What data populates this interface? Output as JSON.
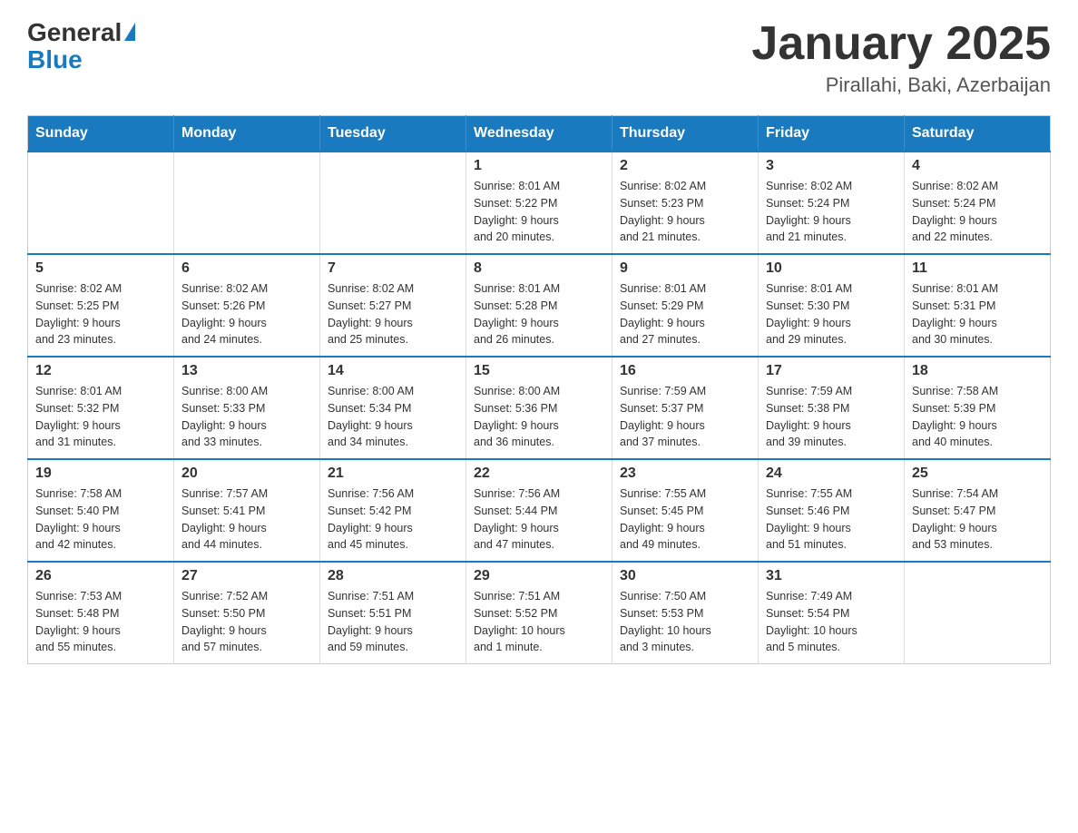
{
  "logo": {
    "general": "General",
    "blue": "Blue"
  },
  "title": "January 2025",
  "subtitle": "Pirallahi, Baki, Azerbaijan",
  "days_of_week": [
    "Sunday",
    "Monday",
    "Tuesday",
    "Wednesday",
    "Thursday",
    "Friday",
    "Saturday"
  ],
  "weeks": [
    [
      {
        "day": "",
        "info": ""
      },
      {
        "day": "",
        "info": ""
      },
      {
        "day": "",
        "info": ""
      },
      {
        "day": "1",
        "info": "Sunrise: 8:01 AM\nSunset: 5:22 PM\nDaylight: 9 hours\nand 20 minutes."
      },
      {
        "day": "2",
        "info": "Sunrise: 8:02 AM\nSunset: 5:23 PM\nDaylight: 9 hours\nand 21 minutes."
      },
      {
        "day": "3",
        "info": "Sunrise: 8:02 AM\nSunset: 5:24 PM\nDaylight: 9 hours\nand 21 minutes."
      },
      {
        "day": "4",
        "info": "Sunrise: 8:02 AM\nSunset: 5:24 PM\nDaylight: 9 hours\nand 22 minutes."
      }
    ],
    [
      {
        "day": "5",
        "info": "Sunrise: 8:02 AM\nSunset: 5:25 PM\nDaylight: 9 hours\nand 23 minutes."
      },
      {
        "day": "6",
        "info": "Sunrise: 8:02 AM\nSunset: 5:26 PM\nDaylight: 9 hours\nand 24 minutes."
      },
      {
        "day": "7",
        "info": "Sunrise: 8:02 AM\nSunset: 5:27 PM\nDaylight: 9 hours\nand 25 minutes."
      },
      {
        "day": "8",
        "info": "Sunrise: 8:01 AM\nSunset: 5:28 PM\nDaylight: 9 hours\nand 26 minutes."
      },
      {
        "day": "9",
        "info": "Sunrise: 8:01 AM\nSunset: 5:29 PM\nDaylight: 9 hours\nand 27 minutes."
      },
      {
        "day": "10",
        "info": "Sunrise: 8:01 AM\nSunset: 5:30 PM\nDaylight: 9 hours\nand 29 minutes."
      },
      {
        "day": "11",
        "info": "Sunrise: 8:01 AM\nSunset: 5:31 PM\nDaylight: 9 hours\nand 30 minutes."
      }
    ],
    [
      {
        "day": "12",
        "info": "Sunrise: 8:01 AM\nSunset: 5:32 PM\nDaylight: 9 hours\nand 31 minutes."
      },
      {
        "day": "13",
        "info": "Sunrise: 8:00 AM\nSunset: 5:33 PM\nDaylight: 9 hours\nand 33 minutes."
      },
      {
        "day": "14",
        "info": "Sunrise: 8:00 AM\nSunset: 5:34 PM\nDaylight: 9 hours\nand 34 minutes."
      },
      {
        "day": "15",
        "info": "Sunrise: 8:00 AM\nSunset: 5:36 PM\nDaylight: 9 hours\nand 36 minutes."
      },
      {
        "day": "16",
        "info": "Sunrise: 7:59 AM\nSunset: 5:37 PM\nDaylight: 9 hours\nand 37 minutes."
      },
      {
        "day": "17",
        "info": "Sunrise: 7:59 AM\nSunset: 5:38 PM\nDaylight: 9 hours\nand 39 minutes."
      },
      {
        "day": "18",
        "info": "Sunrise: 7:58 AM\nSunset: 5:39 PM\nDaylight: 9 hours\nand 40 minutes."
      }
    ],
    [
      {
        "day": "19",
        "info": "Sunrise: 7:58 AM\nSunset: 5:40 PM\nDaylight: 9 hours\nand 42 minutes."
      },
      {
        "day": "20",
        "info": "Sunrise: 7:57 AM\nSunset: 5:41 PM\nDaylight: 9 hours\nand 44 minutes."
      },
      {
        "day": "21",
        "info": "Sunrise: 7:56 AM\nSunset: 5:42 PM\nDaylight: 9 hours\nand 45 minutes."
      },
      {
        "day": "22",
        "info": "Sunrise: 7:56 AM\nSunset: 5:44 PM\nDaylight: 9 hours\nand 47 minutes."
      },
      {
        "day": "23",
        "info": "Sunrise: 7:55 AM\nSunset: 5:45 PM\nDaylight: 9 hours\nand 49 minutes."
      },
      {
        "day": "24",
        "info": "Sunrise: 7:55 AM\nSunset: 5:46 PM\nDaylight: 9 hours\nand 51 minutes."
      },
      {
        "day": "25",
        "info": "Sunrise: 7:54 AM\nSunset: 5:47 PM\nDaylight: 9 hours\nand 53 minutes."
      }
    ],
    [
      {
        "day": "26",
        "info": "Sunrise: 7:53 AM\nSunset: 5:48 PM\nDaylight: 9 hours\nand 55 minutes."
      },
      {
        "day": "27",
        "info": "Sunrise: 7:52 AM\nSunset: 5:50 PM\nDaylight: 9 hours\nand 57 minutes."
      },
      {
        "day": "28",
        "info": "Sunrise: 7:51 AM\nSunset: 5:51 PM\nDaylight: 9 hours\nand 59 minutes."
      },
      {
        "day": "29",
        "info": "Sunrise: 7:51 AM\nSunset: 5:52 PM\nDaylight: 10 hours\nand 1 minute."
      },
      {
        "day": "30",
        "info": "Sunrise: 7:50 AM\nSunset: 5:53 PM\nDaylight: 10 hours\nand 3 minutes."
      },
      {
        "day": "31",
        "info": "Sunrise: 7:49 AM\nSunset: 5:54 PM\nDaylight: 10 hours\nand 5 minutes."
      },
      {
        "day": "",
        "info": ""
      }
    ]
  ]
}
